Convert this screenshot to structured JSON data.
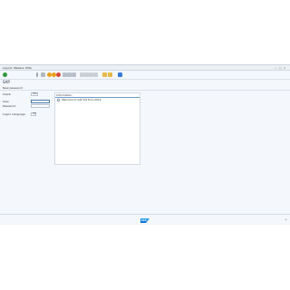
{
  "menu": [
    {
      "label": "Layout"
    },
    {
      "label": "Weitere"
    },
    {
      "label": "Hilfe"
    }
  ],
  "window_controls": [
    "−",
    "□",
    "×"
  ],
  "toolbar": {
    "icons": [
      {
        "name": "enter-icon",
        "color": "#2e9a3a"
      },
      {
        "name": "command-field-icon",
        "color": "#9aa6b3"
      },
      {
        "name": "save-icon",
        "color": "#b0b8c2"
      },
      {
        "name": "back-icon",
        "color": "#e8a21b"
      },
      {
        "name": "exit-icon",
        "color": "#e8a21b"
      },
      {
        "name": "cancel-icon",
        "color": "#d84a3a"
      },
      {
        "name": "print-icon",
        "color": "#b8c0c9"
      },
      {
        "name": "find-icon",
        "color": "#b8c0c9"
      },
      {
        "name": "find-next-icon",
        "color": "#b8c0c9"
      },
      {
        "name": "first-page-icon",
        "color": "#c9cfd6"
      },
      {
        "name": "prev-page-icon",
        "color": "#c9cfd6"
      },
      {
        "name": "next-page-icon",
        "color": "#c9cfd6"
      },
      {
        "name": "last-page-icon",
        "color": "#c9cfd6"
      },
      {
        "name": "create-session-icon",
        "color": "#e6b94a"
      },
      {
        "name": "shortcut-icon",
        "color": "#e6b94a"
      },
      {
        "name": "help-icon",
        "color": "#3a7bd5"
      }
    ]
  },
  "title": "SAP",
  "subtoolbar": {
    "label": "New password"
  },
  "form": {
    "client_label": "Client",
    "client_value": "800",
    "user_label": "User",
    "password_label": "Password",
    "language_label": "Logon Language",
    "language_value": "DE"
  },
  "info": {
    "title": "Information",
    "message": "Welcome to SAP S/4 Euro 2016"
  },
  "statusbar": {
    "logo_text": "SAP"
  }
}
